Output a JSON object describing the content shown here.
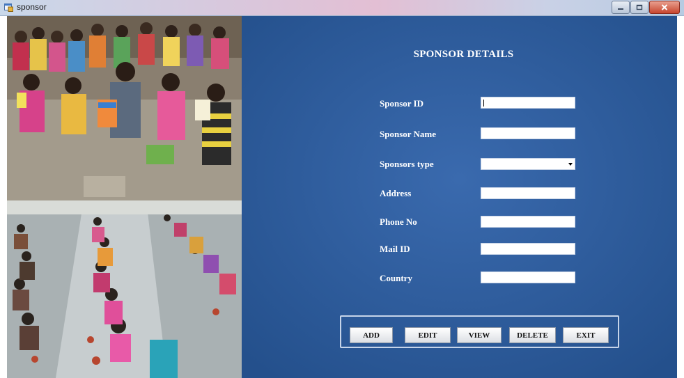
{
  "window": {
    "title": "sponsor",
    "controls": {
      "minimize": "minimize-icon",
      "maximize": "maximize-icon",
      "close": "close-icon"
    }
  },
  "form": {
    "heading": "SPONSOR DETAILS",
    "fields": [
      {
        "label": "Sponsor ID",
        "type": "text",
        "value": ""
      },
      {
        "label": "Sponsor Name",
        "type": "text",
        "value": ""
      },
      {
        "label": "Sponsors type",
        "type": "dropdown",
        "value": ""
      },
      {
        "label": "Address",
        "type": "text",
        "value": ""
      },
      {
        "label": "Phone No",
        "type": "text",
        "value": ""
      },
      {
        "label": "Mail ID",
        "type": "text",
        "value": ""
      },
      {
        "label": "Country",
        "type": "text",
        "value": ""
      }
    ],
    "buttons": [
      "ADD",
      "EDIT",
      "VIEW",
      "DELETE",
      "EXIT"
    ]
  },
  "colors": {
    "panel": "#2c5a9a",
    "field": "#ffffff",
    "label": "#ffffff"
  }
}
